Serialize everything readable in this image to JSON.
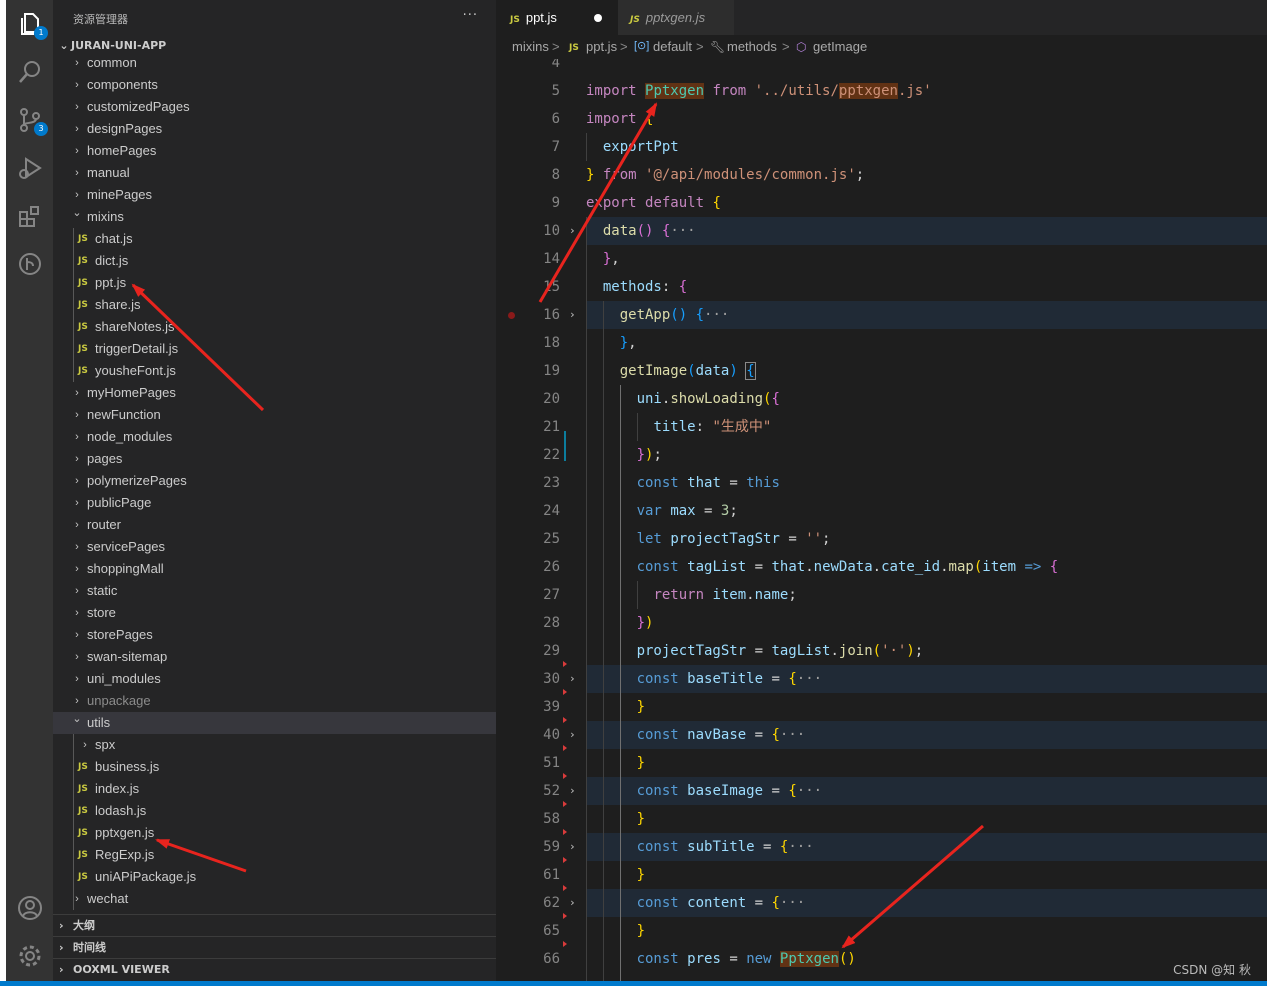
{
  "activity_bar": {
    "items": [
      {
        "name": "explorer-icon",
        "badge": "1"
      },
      {
        "name": "search-icon"
      },
      {
        "name": "source-control-icon",
        "badge": "3"
      },
      {
        "name": "run-debug-icon"
      },
      {
        "name": "extensions-icon"
      },
      {
        "name": "git-graph-icon"
      },
      {
        "name": "account-icon"
      },
      {
        "name": "manage-gear-icon"
      }
    ]
  },
  "sidebar": {
    "title": "资源管理器",
    "more": "···",
    "project": "JURAN-UNI-APP",
    "tree": [
      {
        "label": "common",
        "type": "folder",
        "depth": 1,
        "expanded": false
      },
      {
        "label": "components",
        "type": "folder",
        "depth": 1,
        "expanded": false
      },
      {
        "label": "customizedPages",
        "type": "folder",
        "depth": 1,
        "expanded": false
      },
      {
        "label": "designPages",
        "type": "folder",
        "depth": 1,
        "expanded": false
      },
      {
        "label": "homePages",
        "type": "folder",
        "depth": 1,
        "expanded": false
      },
      {
        "label": "manual",
        "type": "folder",
        "depth": 1,
        "expanded": false
      },
      {
        "label": "minePages",
        "type": "folder",
        "depth": 1,
        "expanded": false
      },
      {
        "label": "mixins",
        "type": "folder",
        "depth": 1,
        "expanded": true
      },
      {
        "label": "chat.js",
        "type": "js",
        "depth": 2
      },
      {
        "label": "dict.js",
        "type": "js",
        "depth": 2
      },
      {
        "label": "ppt.js",
        "type": "js",
        "depth": 2
      },
      {
        "label": "share.js",
        "type": "js",
        "depth": 2
      },
      {
        "label": "shareNotes.js",
        "type": "js",
        "depth": 2
      },
      {
        "label": "triggerDetail.js",
        "type": "js",
        "depth": 2
      },
      {
        "label": "yousheFont.js",
        "type": "js",
        "depth": 2
      },
      {
        "label": "myHomePages",
        "type": "folder",
        "depth": 1,
        "expanded": false
      },
      {
        "label": "newFunction",
        "type": "folder",
        "depth": 1,
        "expanded": false
      },
      {
        "label": "node_modules",
        "type": "folder",
        "depth": 1,
        "expanded": false
      },
      {
        "label": "pages",
        "type": "folder",
        "depth": 1,
        "expanded": false
      },
      {
        "label": "polymerizePages",
        "type": "folder",
        "depth": 1,
        "expanded": false
      },
      {
        "label": "publicPage",
        "type": "folder",
        "depth": 1,
        "expanded": false
      },
      {
        "label": "router",
        "type": "folder",
        "depth": 1,
        "expanded": false
      },
      {
        "label": "servicePages",
        "type": "folder",
        "depth": 1,
        "expanded": false
      },
      {
        "label": "shoppingMall",
        "type": "folder",
        "depth": 1,
        "expanded": false
      },
      {
        "label": "static",
        "type": "folder",
        "depth": 1,
        "expanded": false
      },
      {
        "label": "store",
        "type": "folder",
        "depth": 1,
        "expanded": false
      },
      {
        "label": "storePages",
        "type": "folder",
        "depth": 1,
        "expanded": false
      },
      {
        "label": "swan-sitemap",
        "type": "folder",
        "depth": 1,
        "expanded": false
      },
      {
        "label": "uni_modules",
        "type": "folder",
        "depth": 1,
        "expanded": false
      },
      {
        "label": "unpackage",
        "type": "folder",
        "depth": 1,
        "expanded": false,
        "dim": true
      },
      {
        "label": "utils",
        "type": "folder",
        "depth": 1,
        "expanded": true,
        "selected": true
      },
      {
        "label": "spx",
        "type": "folder",
        "depth": 2,
        "expanded": false
      },
      {
        "label": "business.js",
        "type": "js",
        "depth": 2
      },
      {
        "label": "index.js",
        "type": "js",
        "depth": 2
      },
      {
        "label": "lodash.js",
        "type": "js",
        "depth": 2
      },
      {
        "label": "pptxgen.js",
        "type": "js",
        "depth": 2
      },
      {
        "label": "RegExp.js",
        "type": "js",
        "depth": 2
      },
      {
        "label": "uniAPiPackage.js",
        "type": "js",
        "depth": 2
      },
      {
        "label": "wechat",
        "type": "folder",
        "depth": 1,
        "expanded": false
      }
    ],
    "panels": [
      "大纲",
      "时间线",
      "OOXML VIEWER"
    ]
  },
  "tabs": [
    {
      "label": "ppt.js",
      "icon": "JS",
      "active": true,
      "dirty": true
    },
    {
      "label": "pptxgen.js",
      "icon": "JS",
      "active": false,
      "italic": true
    }
  ],
  "breadcrumb": {
    "folder": "mixins",
    "file_icon": "JS",
    "file": "ppt.js",
    "item1": "default",
    "item2": "methods",
    "item3": "getImage",
    "sep": ">"
  },
  "editor": {
    "lines": [
      {
        "n": "4",
        "html": ""
      },
      {
        "n": "5",
        "html": "<span class=\"kw2\">import</span> <span class=\"cls mark\">Pptxgen</span> <span class=\"kw2\">from</span> <span class=\"str\">'../utils/</span><span class=\"str mark\">pptxgen</span><span class=\"str\">.js'</span>"
      },
      {
        "n": "6",
        "html": "<span class=\"kw2\">import</span> <span class=\"br1\">{</span>"
      },
      {
        "n": "7",
        "html": "  <span class=\"var\">exportPpt</span>"
      },
      {
        "n": "8",
        "html": "<span class=\"br1\">}</span> <span class=\"kw2\">from</span> <span class=\"str\">'@/api/modules/common.js'</span>;"
      },
      {
        "n": "9",
        "html": "<span class=\"kw2\">export</span> <span class=\"kw2\">default</span> <span class=\"br1\">{</span>"
      },
      {
        "n": "10",
        "html": "  <span class=\"fn\">data</span><span class=\"br2\">()</span> <span class=\"br2\">{</span><span class=\"fld\">···</span>",
        "fold": true,
        "hl": true
      },
      {
        "n": "14",
        "html": "  <span class=\"br2\">}</span>,"
      },
      {
        "n": "15",
        "html": "  <span class=\"var\">methods</span>: <span class=\"br2\">{</span>"
      },
      {
        "n": "16",
        "html": "    <span class=\"fn\">getApp</span><span class=\"br3\">()</span> <span class=\"br3\">{</span><span class=\"fld\">···</span>",
        "fold": true,
        "hl": true,
        "bp": true
      },
      {
        "n": "18",
        "html": "    <span class=\"br3\">}</span>,"
      },
      {
        "n": "19",
        "html": "    <span class=\"fn\">getImage</span><span class=\"br3\">(</span><span class=\"var\">data</span><span class=\"br3\">)</span> <span class=\"br3 boxed\">{</span>"
      },
      {
        "n": "20",
        "html": "      <span class=\"var\">uni</span>.<span class=\"fn\">showLoading</span><span class=\"br1\">(</span><span class=\"br2\">{</span>"
      },
      {
        "n": "21",
        "html": "        <span class=\"var\">title</span>: <span class=\"str\">\"生成中\"</span>"
      },
      {
        "n": "22",
        "html": "      <span class=\"br2\">}</span><span class=\"br1\">)</span>;",
        "mod": true
      },
      {
        "n": "23",
        "html": "      <span class=\"kw\">const</span> <span class=\"var\">that</span> = <span class=\"kw\">this</span>"
      },
      {
        "n": "24",
        "html": "      <span class=\"kw\">var</span> <span class=\"var\">max</span> = <span class=\"num\">3</span>;"
      },
      {
        "n": "25",
        "html": "      <span class=\"kw\">let</span> <span class=\"var\">projectTagStr</span> = <span class=\"str\">''</span>;"
      },
      {
        "n": "26",
        "html": "      <span class=\"kw\">const</span> <span class=\"var\">tagList</span> = <span class=\"var\">that</span>.<span class=\"var\">newData</span>.<span class=\"var\">cate_id</span>.<span class=\"fn\">map</span><span class=\"br1\">(</span><span class=\"var\">item</span> <span class=\"kw\">=&gt;</span> <span class=\"br2\">{</span>"
      },
      {
        "n": "27",
        "html": "        <span class=\"kw2\">return</span> <span class=\"var\">item</span>.<span class=\"var\">name</span>;"
      },
      {
        "n": "28",
        "html": "      <span class=\"br2\">}</span><span class=\"br1\">)</span>"
      },
      {
        "n": "29",
        "html": "      <span class=\"var\">projectTagStr</span> = <span class=\"var\">tagList</span>.<span class=\"fn\">join</span><span class=\"br1\">(</span><span class=\"str\">'·'</span><span class=\"br1\">)</span>;"
      },
      {
        "n": "30",
        "html": "      <span class=\"kw\">const</span> <span class=\"var\">baseTitle</span> = <span class=\"br1\">{</span><span class=\"fld\">···</span>",
        "fold": true,
        "hl": true,
        "mark": true
      },
      {
        "n": "39",
        "html": "      <span class=\"br1\">}</span>",
        "mark": true
      },
      {
        "n": "40",
        "html": "      <span class=\"kw\">const</span> <span class=\"var\">navBase</span> = <span class=\"br1\">{</span><span class=\"fld\">···</span>",
        "fold": true,
        "hl": true,
        "mark": true
      },
      {
        "n": "51",
        "html": "      <span class=\"br1\">}</span>",
        "mark": true
      },
      {
        "n": "52",
        "html": "      <span class=\"kw\">const</span> <span class=\"var\">baseImage</span> = <span class=\"br1\">{</span><span class=\"fld\">···</span>",
        "fold": true,
        "hl": true,
        "mark": true
      },
      {
        "n": "58",
        "html": "      <span class=\"br1\">}</span>",
        "mark": true
      },
      {
        "n": "59",
        "html": "      <span class=\"kw\">const</span> <span class=\"var\">subTitle</span> = <span class=\"br1\">{</span><span class=\"fld\">···</span>",
        "fold": true,
        "hl": true,
        "mark": true
      },
      {
        "n": "61",
        "html": "      <span class=\"br1\">}</span>",
        "mark": true
      },
      {
        "n": "62",
        "html": "      <span class=\"kw\">const</span> <span class=\"var\">content</span> = <span class=\"br1\">{</span><span class=\"fld\">···</span>",
        "fold": true,
        "hl": true,
        "mark": true
      },
      {
        "n": "65",
        "html": "      <span class=\"br1\">}</span>",
        "mark": true
      },
      {
        "n": "66",
        "html": "      <span class=\"kw\">const</span> <span class=\"var\">pres</span> = <span class=\"kw\">new</span> <span class=\"cls mark\">Pptxgen</span><span class=\"br1\">()</span>",
        "mark": true
      }
    ]
  },
  "watermark": "CSDN @知 秋",
  "colors": {
    "activity_bar": "#333333",
    "sidebar": "#252526",
    "editor": "#1e1e1e",
    "accent": "#007acc",
    "annotation_arrow": "#e8241e"
  }
}
